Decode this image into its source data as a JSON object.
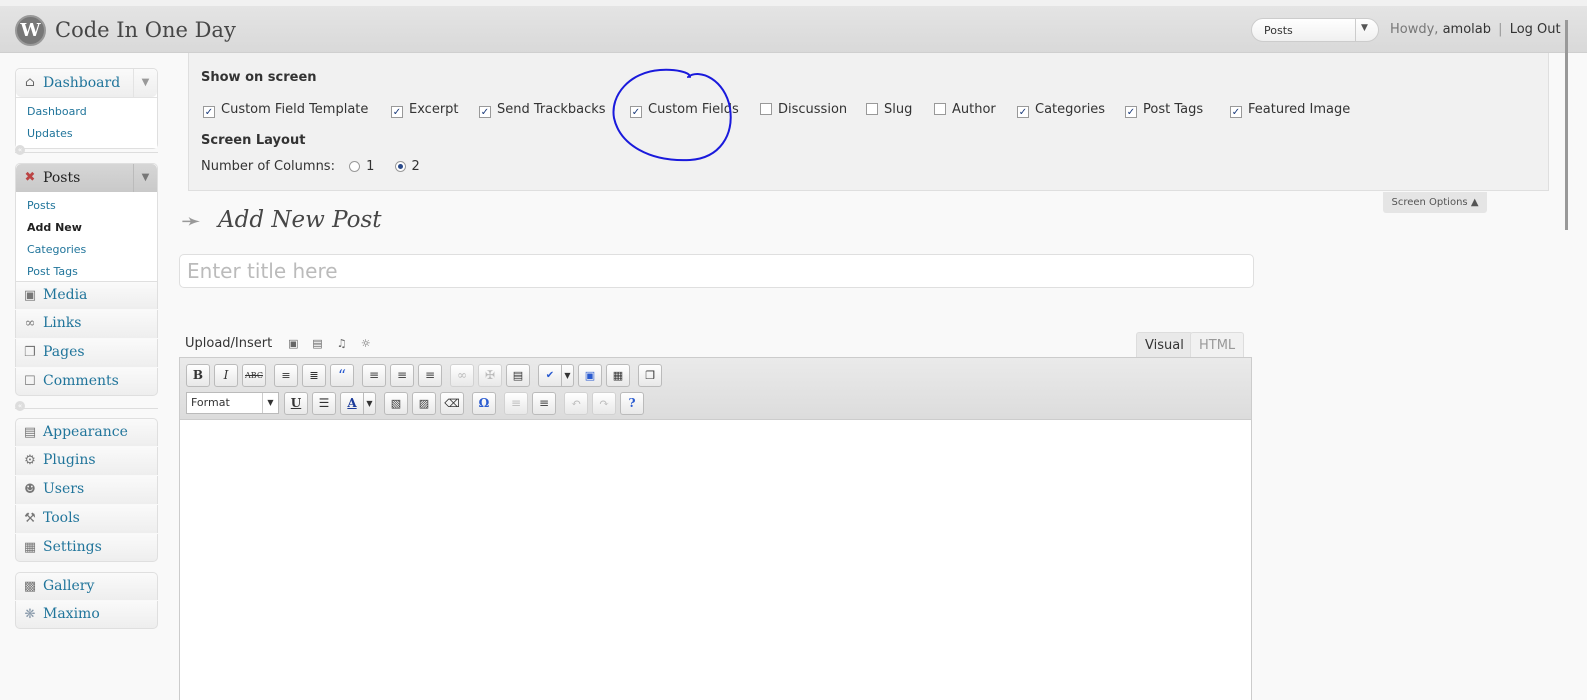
{
  "header": {
    "logo": "W",
    "site_title": "Code In One Day",
    "favorite_actions": {
      "selected": "Posts"
    },
    "howdy": "Howdy,",
    "username": "amolab",
    "separator": "|",
    "logout": "Log Out"
  },
  "sidebar": {
    "dashboard": {
      "label": "Dashboard",
      "items": [
        "Dashboard",
        "Updates"
      ]
    },
    "posts": {
      "label": "Posts",
      "items": [
        "Posts",
        "Add New",
        "Categories",
        "Post Tags"
      ]
    },
    "menu1": [
      "Media",
      "Links",
      "Pages",
      "Comments"
    ],
    "menu2": [
      "Appearance",
      "Plugins",
      "Users",
      "Tools",
      "Settings"
    ],
    "menu3": [
      "Gallery",
      "Maximo"
    ]
  },
  "screen_options": {
    "show_heading": "Show on screen",
    "options": [
      {
        "label": "Custom Field Template",
        "checked": true
      },
      {
        "label": "Excerpt",
        "checked": true
      },
      {
        "label": "Send Trackbacks",
        "checked": true
      },
      {
        "label": "Custom Fields",
        "checked": true
      },
      {
        "label": "Discussion",
        "checked": false
      },
      {
        "label": "Slug",
        "checked": false
      },
      {
        "label": "Author",
        "checked": false
      },
      {
        "label": "Categories",
        "checked": true
      },
      {
        "label": "Post Tags",
        "checked": true
      },
      {
        "label": "Featured Image",
        "checked": true
      }
    ],
    "layout_heading": "Screen Layout",
    "columns_label": "Number of Columns:",
    "columns": [
      "1",
      "2"
    ],
    "columns_selected": "2",
    "tab_label": "Screen Options"
  },
  "main": {
    "page_title": "Add New Post",
    "title_placeholder": "Enter title here",
    "upload_insert": "Upload/Insert",
    "tab_visual": "Visual",
    "tab_html": "HTML",
    "format_select": "Format"
  },
  "colors": {
    "link": "#21759b",
    "annotation": "#1a1adc"
  }
}
